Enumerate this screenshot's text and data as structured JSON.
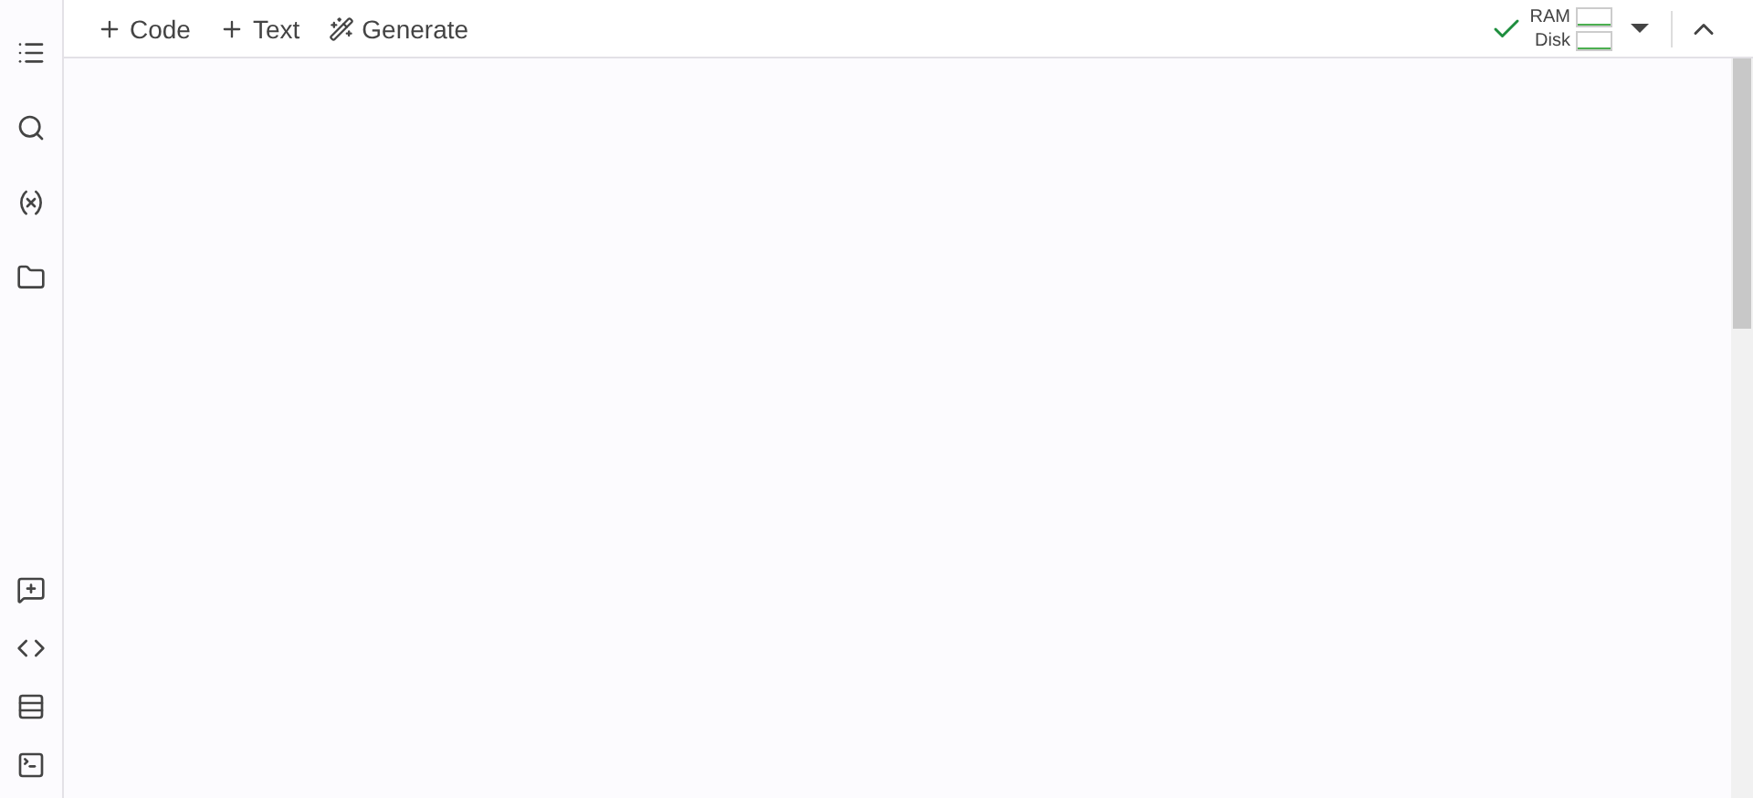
{
  "toolbar": {
    "actions": [
      {
        "kind": "add",
        "label": "Code"
      },
      {
        "kind": "add",
        "label": "Text"
      },
      {
        "kind": "generate",
        "label": "Generate"
      }
    ],
    "resources": [
      {
        "label": "RAM"
      },
      {
        "label": "Disk"
      }
    ],
    "connected": true
  }
}
